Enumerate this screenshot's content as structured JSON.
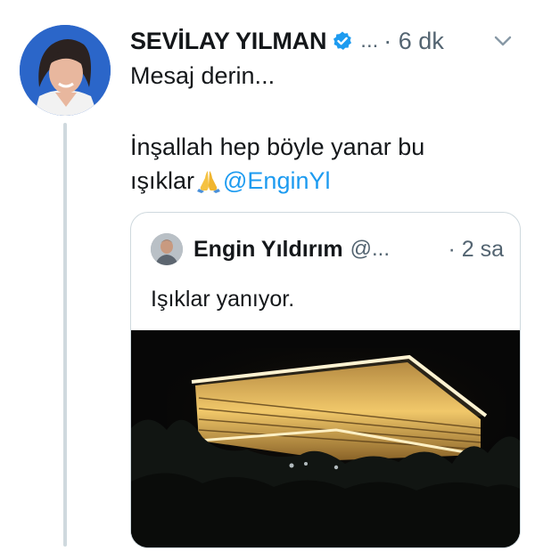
{
  "tweet": {
    "display_name": "SEVİLAY YILMAN",
    "handle": "...",
    "time": "· 6 dk",
    "text_line1": "Mesaj derin...",
    "text_line2a": "İnşallah hep böyle yanar bu",
    "text_line2b": "ışıklar",
    "mention": "@EnginYl"
  },
  "quote": {
    "display_name": "Engin Yıldırım",
    "handle": "@...",
    "time": "· 2 sa",
    "text": "Işıklar yanıyor."
  },
  "colors": {
    "link": "#1d9bf0",
    "verified": "#1d9bf0",
    "secondary_text": "#536471",
    "border": "#cfd9de"
  },
  "icons": {
    "verified": "verified-badge-icon",
    "caret": "chevron-down-icon",
    "emoji": "folded-hands-emoji"
  }
}
